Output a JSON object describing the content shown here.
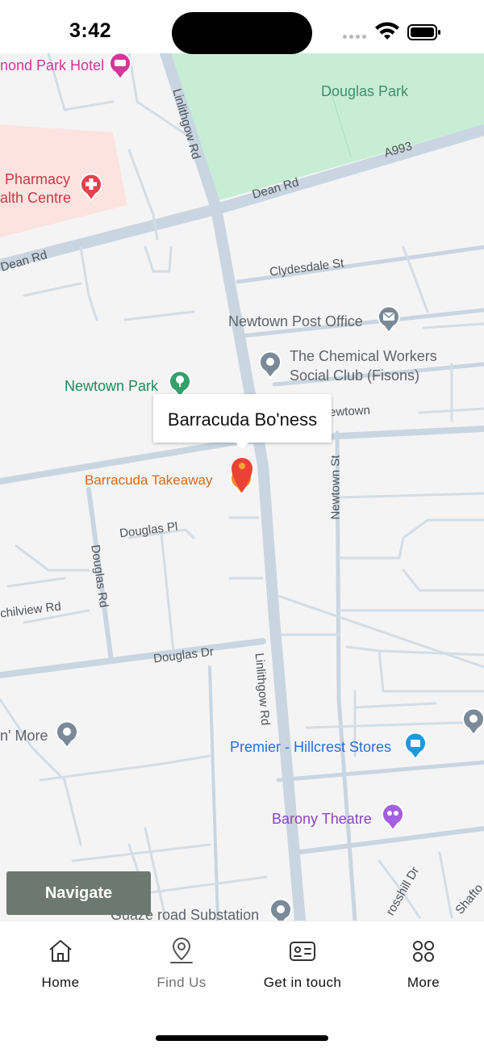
{
  "status_bar": {
    "time": "3:42"
  },
  "map": {
    "callout_title": "Barracuda Bo'ness",
    "road_labels": {
      "linlithgow_rd_top": "Linlithgow Rd",
      "linlithgow_rd_bottom": "Linlithgow Rd",
      "dean_rd_left": "Dean Rd",
      "dean_rd_right": "Dean Rd",
      "a993": "A993",
      "clydesdale_st": "Clydesdale St",
      "newtown_st": "Newtown St",
      "newtown_partial": "ewtown",
      "douglas_pl": "Douglas Pl",
      "douglas_rd": "Douglas Rd",
      "douglas_dr": "Douglas Dr",
      "chilview_rd": "chilview Rd",
      "crosshill_dr": "rosshill Dr",
      "shafto": "Shafto"
    },
    "places": {
      "douglas_park": "Douglas Park",
      "richmond_park_hotel": "nond Park Hotel",
      "pharmacy": "Pharmacy",
      "health_centre": "alth Centre",
      "newtown_post_office": "Newtown Post Office",
      "chemical_workers_line1": "The Chemical Workers",
      "chemical_workers_line2": "Social Club (Fisons)",
      "newtown_park": "Newtown Park",
      "barracuda_takeaway": "Barracuda Takeaway",
      "n_more": "n' More",
      "premier_hillcrest": "Premier - Hillcrest Stores",
      "barony_theatre": "Barony Theatre",
      "guaze_road_substation": "Guaze road Substation"
    },
    "navigate_label": "Navigate"
  },
  "tabs": [
    {
      "label": "Home",
      "icon": "home-icon"
    },
    {
      "label": "Find Us",
      "icon": "location-pin-icon"
    },
    {
      "label": "Get in touch",
      "icon": "contact-card-icon"
    },
    {
      "label": "More",
      "icon": "grid-icon"
    }
  ],
  "active_tab": "Find Us",
  "colors": {
    "map_bg": "#f5f4f5",
    "road": "#c9d6e1",
    "park": "#c7eed5",
    "medical_area": "#fde3df",
    "marker": "#ea4335",
    "navigate_bg": "#6d7870"
  }
}
